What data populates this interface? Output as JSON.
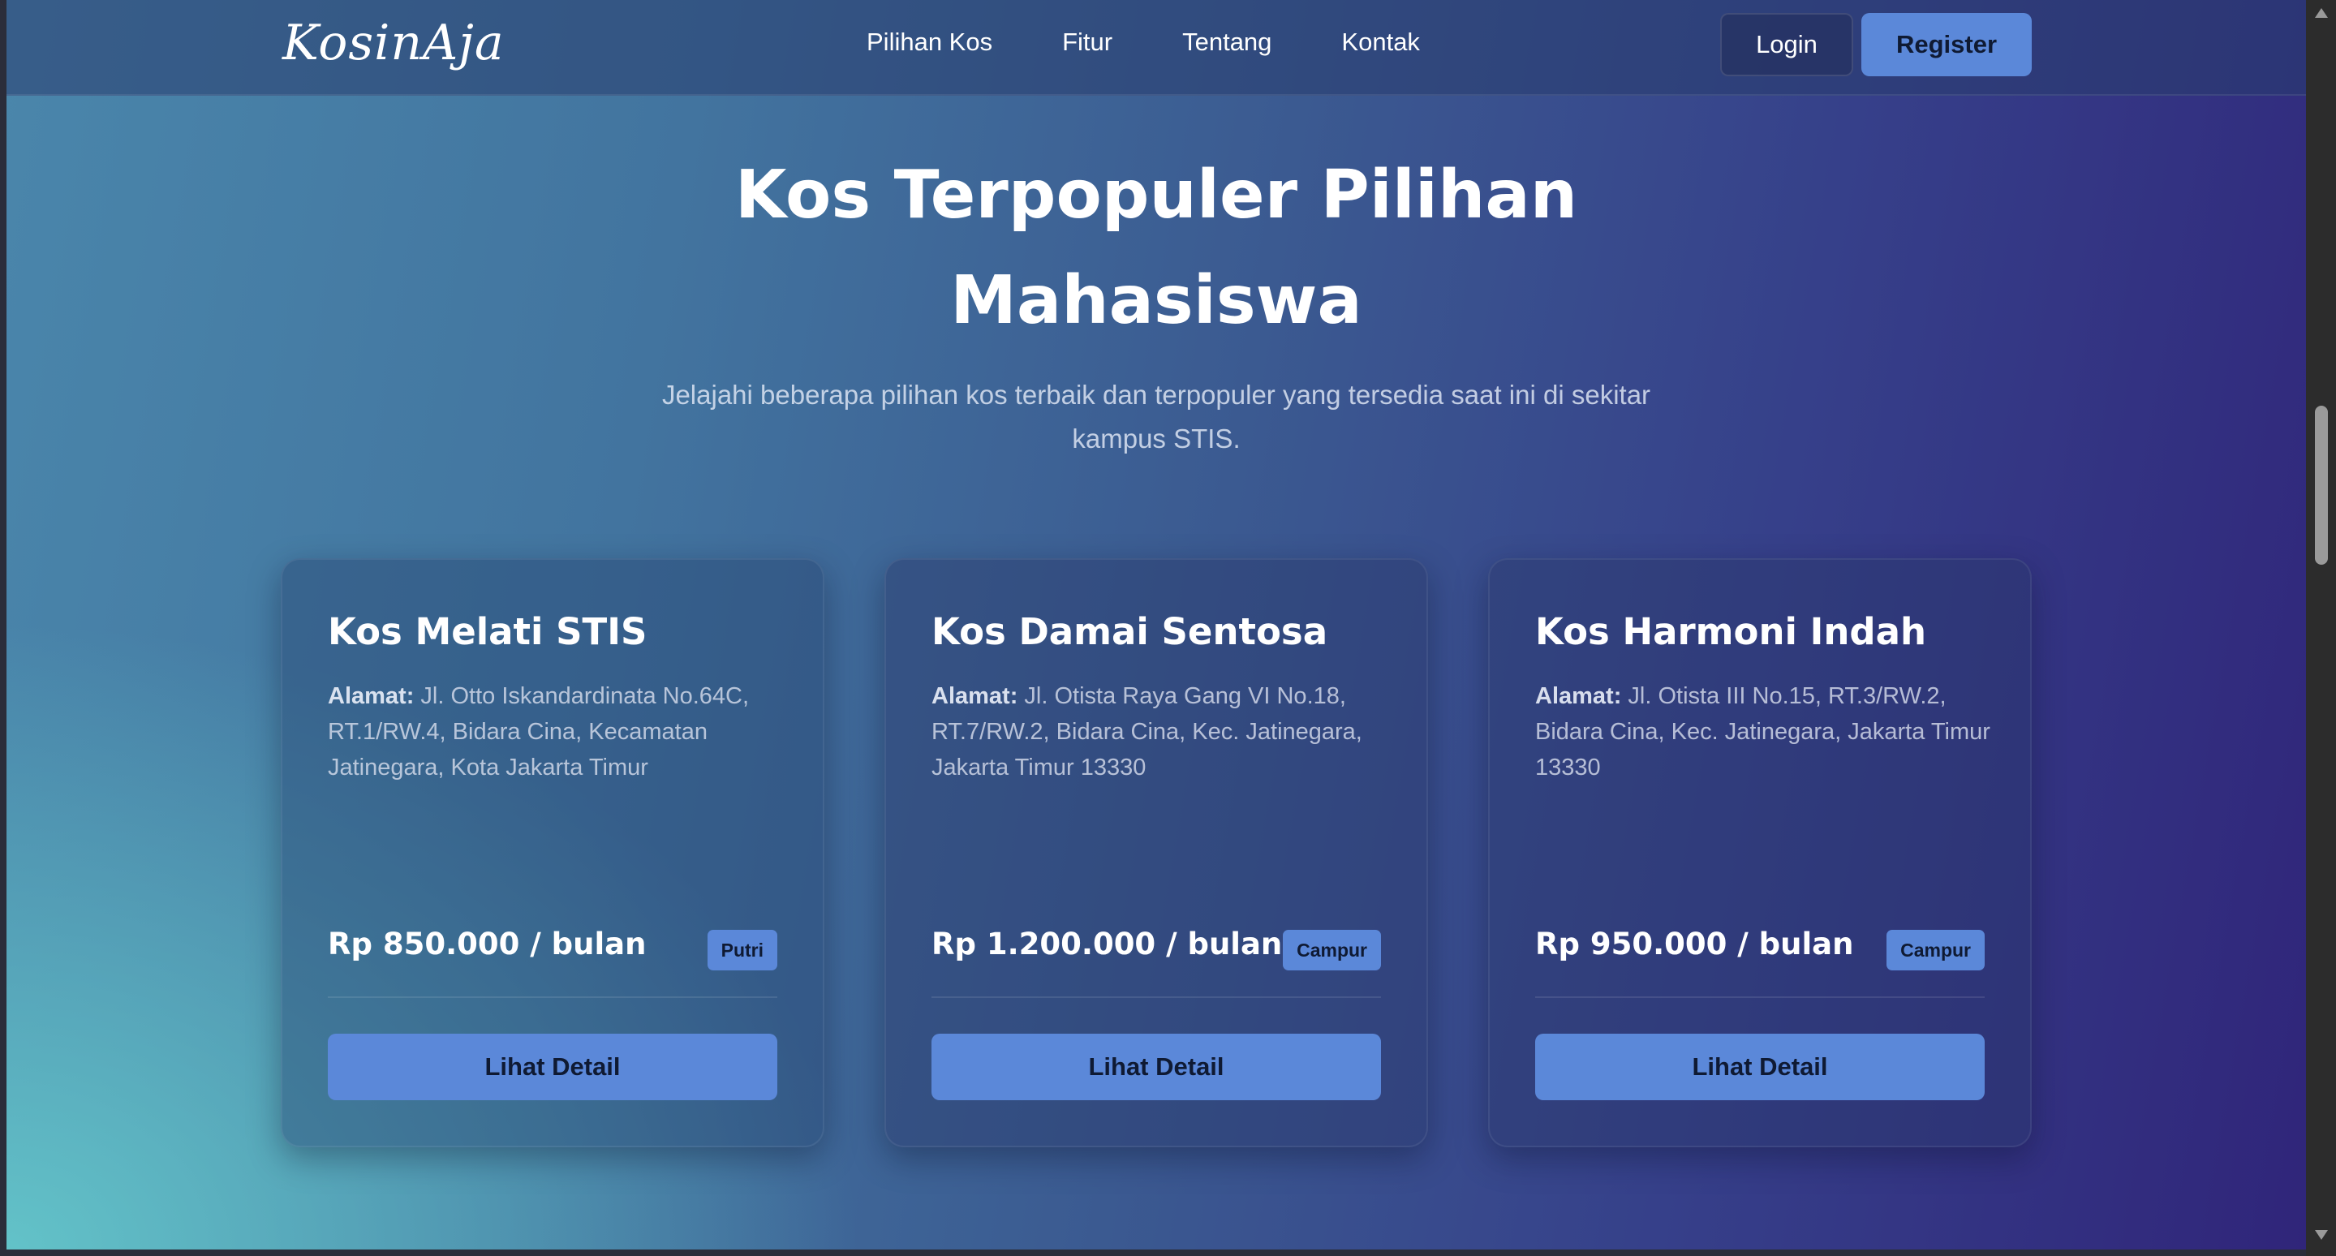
{
  "navbar": {
    "logo": "KosinAja",
    "links": [
      "Pilihan Kos",
      "Fitur",
      "Tentang",
      "Kontak"
    ],
    "login_label": "Login",
    "register_label": "Register"
  },
  "hero": {
    "heading_line1": "Kos Terpopuler Pilihan",
    "heading_line2": "Mahasiswa",
    "subtext_line1": "Jelajahi beberapa pilihan kos terbaik dan terpopuler yang tersedia saat ini di sekitar",
    "subtext_line2": "kampus STIS."
  },
  "cards": [
    {
      "title": "Kos Melati STIS",
      "address_label": "Alamat:",
      "address": "Jl. Otto Iskandardinata No.64C, RT.1/RW.4, Bidara Cina, Kecamatan Jatinegara, Kota Jakarta Timur",
      "price": "Rp 850.000 / bulan",
      "badge": "Putri",
      "button_label": "Lihat Detail"
    },
    {
      "title": "Kos Damai Sentosa",
      "address_label": "Alamat:",
      "address": "Jl. Otista Raya Gang VI No.18, RT.7/RW.2, Bidara Cina, Kec. Jatinegara, Jakarta Timur 13330",
      "price": "Rp 1.200.000 / bulan",
      "badge": "Campur",
      "button_label": "Lihat Detail"
    },
    {
      "title": "Kos Harmoni Indah",
      "address_label": "Alamat:",
      "address": "Jl. Otista III No.15, RT.3/RW.2, Bidara Cina, Kec. Jatinegara, Jakarta Timur 13330",
      "price": "Rp 950.000 / bulan",
      "badge": "Campur",
      "button_label": "Lihat Detail"
    }
  ],
  "colors": {
    "accent": "#5b88d9",
    "button_text": "#0f1a33"
  }
}
